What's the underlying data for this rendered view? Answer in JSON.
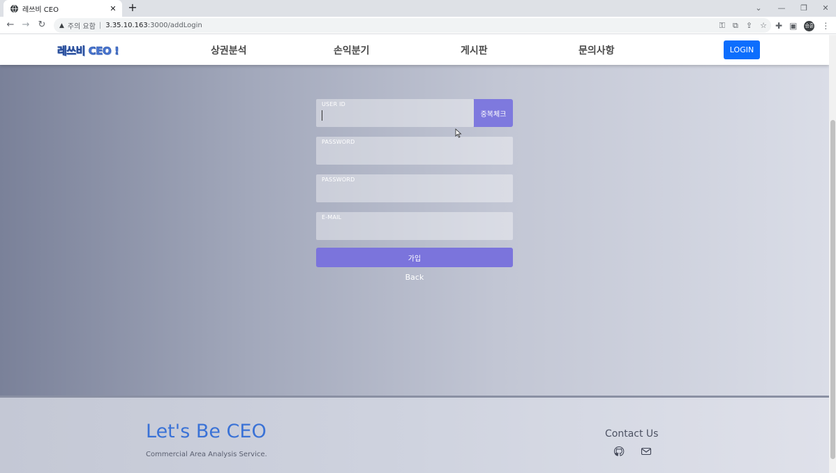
{
  "browser": {
    "tab_title": "레쓰비 CEO",
    "security_label": "주의 요함",
    "url_host": "3.35.10.163",
    "url_path": ":3000/addLogin",
    "profile_initials": "승훈"
  },
  "site": {
    "logo": "레쓰비 CEO !",
    "nav": [
      "상권분석",
      "손익분기",
      "게시판",
      "문의사항"
    ],
    "login_label": "LOGIN"
  },
  "form": {
    "userid_label": "USER ID",
    "userid_value": "",
    "dup_check_label": "중복체크",
    "password_label": "PASSWORD",
    "password_confirm_label": "PASSWORD",
    "email_label": "E-MAIL",
    "submit_label": "가입",
    "back_label": "Back"
  },
  "footer": {
    "title": "Let's Be CEO",
    "subtitle": "Commercial Area Analysis Service.",
    "contact_title": "Contact Us",
    "icons": [
      "github-icon",
      "mail-icon"
    ]
  },
  "colors": {
    "accent": "#7b74dc",
    "login_button": "#0d6efd",
    "footer_title": "#3a72d6"
  }
}
